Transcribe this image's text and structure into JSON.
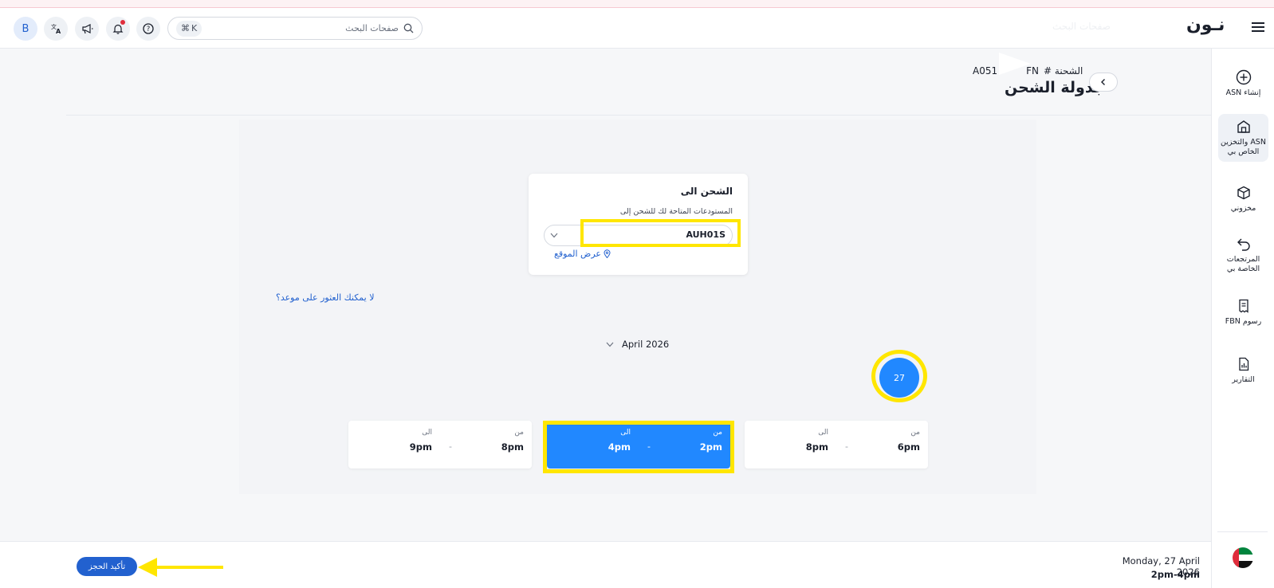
{
  "header": {
    "logo": "نـون",
    "logo_faded": "صفحات البحث",
    "search_placeholder": "صفحات البحث",
    "search_shortcut_key": "K",
    "avatar_initial": "B"
  },
  "sidebar": {
    "items": [
      {
        "label": "إنشاء ASN",
        "icon": "plus-circle-icon"
      },
      {
        "label": "ASN والتخزين الخاص بي",
        "icon": "warehouse-icon"
      },
      {
        "label": "مخزوني",
        "icon": "box-icon"
      },
      {
        "label": "المرتجعات الخاصة بي",
        "icon": "return-icon"
      },
      {
        "label": "رسوم FBN",
        "icon": "receipt-icon"
      },
      {
        "label": "التقارير",
        "icon": "report-icon"
      }
    ],
    "flag": "uae-flag-icon"
  },
  "page": {
    "shipment_label": "الشحنة #",
    "shipment_number": "A051",
    "shipment_fragment": "FN",
    "title": "جدولة الشحن"
  },
  "ship_to": {
    "title": "الشحن الى",
    "subtitle": "المستودعات المتاحة لك للشحن إلى",
    "selected_warehouse": "AUH01S",
    "location_link": "عرض الموقع"
  },
  "no_slot_link": "لا يمكنك العثور على موعد؟",
  "calendar": {
    "month": "April 2026",
    "selected_day": "27"
  },
  "slots": [
    {
      "from_label": "من",
      "from": "6pm",
      "to_label": "الى",
      "to": "8pm",
      "selected": false
    },
    {
      "from_label": "من",
      "from": "2pm",
      "to_label": "الى",
      "to": "4pm",
      "selected": true
    },
    {
      "from_label": "من",
      "from": "8pm",
      "to_label": "الى",
      "to": "9pm",
      "selected": false
    }
  ],
  "footer": {
    "confirm_label": "تأكيد الحجز",
    "selected_date": "Monday, 27 April 2026",
    "selected_time": "2pm-4pm"
  },
  "colors": {
    "accent_blue": "#2188ff",
    "link_blue": "#2261cf",
    "annotation_yellow": "#ffe600"
  }
}
